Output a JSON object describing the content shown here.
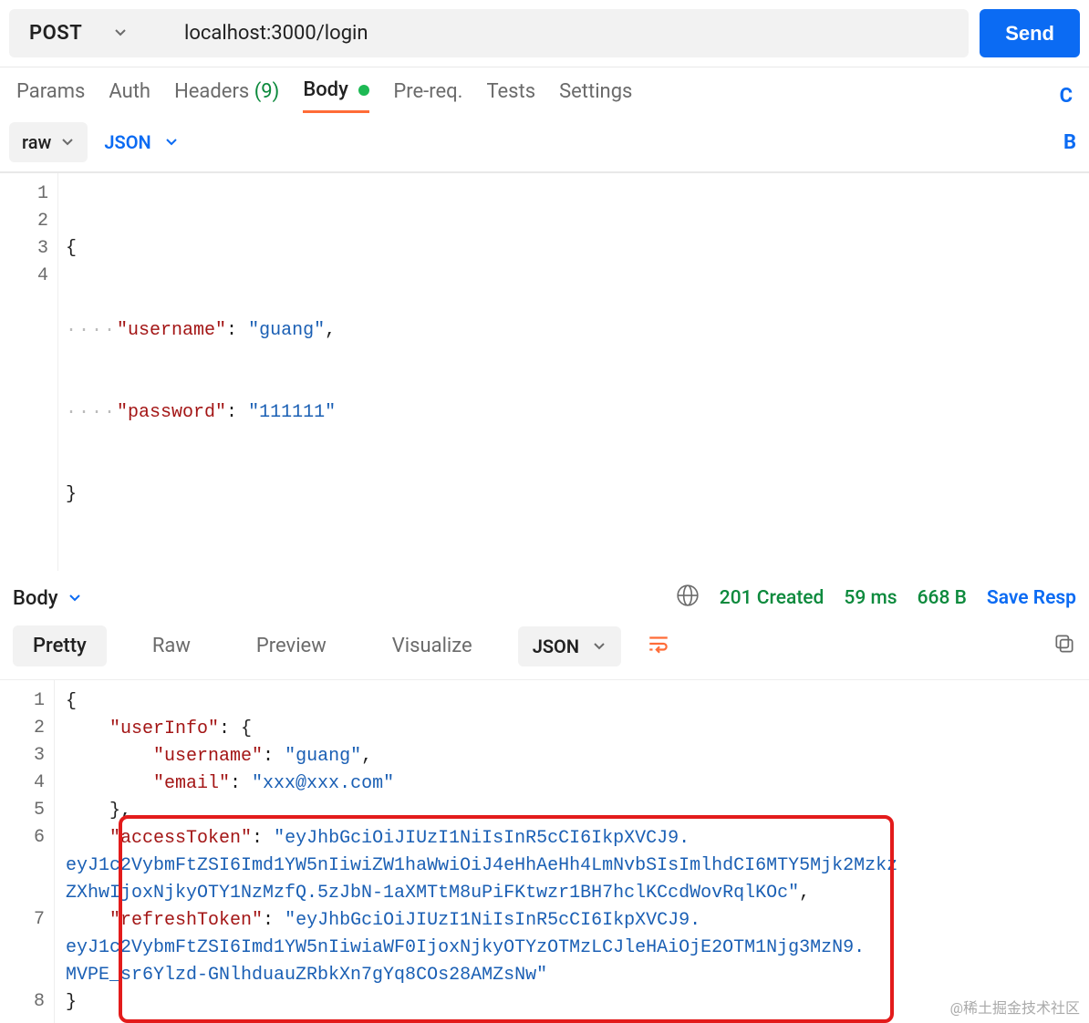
{
  "request": {
    "method": "POST",
    "url": "localhost:3000/login",
    "send_label": "Send"
  },
  "tabs": {
    "params": "Params",
    "auth": "Auth",
    "headers": "Headers",
    "headers_count": "(9)",
    "body": "Body",
    "prereq": "Pre-req.",
    "tests": "Tests",
    "settings": "Settings",
    "shortcut_right": "C"
  },
  "body_controls": {
    "raw_label": "raw",
    "format_label": "JSON",
    "shortcut_right": "B"
  },
  "request_body": {
    "lines": [
      "1",
      "2",
      "3",
      "4"
    ],
    "key_username": "\"username\"",
    "val_username": "\"guang\"",
    "key_password": "\"password\"",
    "val_password": "\"111111\""
  },
  "response_header": {
    "body_label": "Body",
    "status": "201 Created",
    "time": "59 ms",
    "size": "668 B",
    "save_label": "Save Resp"
  },
  "response_tabs": {
    "pretty": "Pretty",
    "raw": "Raw",
    "preview": "Preview",
    "visualize": "Visualize",
    "format": "JSON"
  },
  "response_body": {
    "gutter": [
      "1",
      "2",
      "3",
      "4",
      "5",
      "6",
      "",
      "",
      "7",
      "",
      "",
      "8"
    ],
    "key_userInfo": "\"userInfo\"",
    "key_username": "\"username\"",
    "val_username": "\"guang\"",
    "key_email": "\"email\"",
    "val_email": "\"xxx@xxx.com\"",
    "key_accessToken": "\"accessToken\"",
    "val_accessToken_1": "\"eyJhbGciOiJIUzI1NiIsInR5cCI6IkpXVCJ9.",
    "val_accessToken_2": "eyJ1c2VybmFtZSI6Imd1YW5nIiwiZW1haWwiOiJ4eHhAeHh4LmNvbSIsImlhdCI6MTY5Mjk2Mzkz",
    "val_accessToken_3": "ZXhwIjoxNjkyOTY1NzMzfQ.5zJbN-1aXMTtM8uPiFKtwzr1BH7hclKCcdWovRqlKOc\"",
    "key_refreshToken": "\"refreshToken\"",
    "val_refreshToken_1": "\"eyJhbGciOiJIUzI1NiIsInR5cCI6IkpXVCJ9.",
    "val_refreshToken_2": "eyJ1c2VybmFtZSI6Imd1YW5nIiwiaWF0IjoxNjkyOTYzOTMzLCJleHAiOjE2OTM1Njg3MzN9.",
    "val_refreshToken_3": "MVPE_sr6Ylzd-GNlhduauZRbkXn7gYq8COs28AMZsNw\""
  },
  "watermark": "@稀土掘金技术社区"
}
